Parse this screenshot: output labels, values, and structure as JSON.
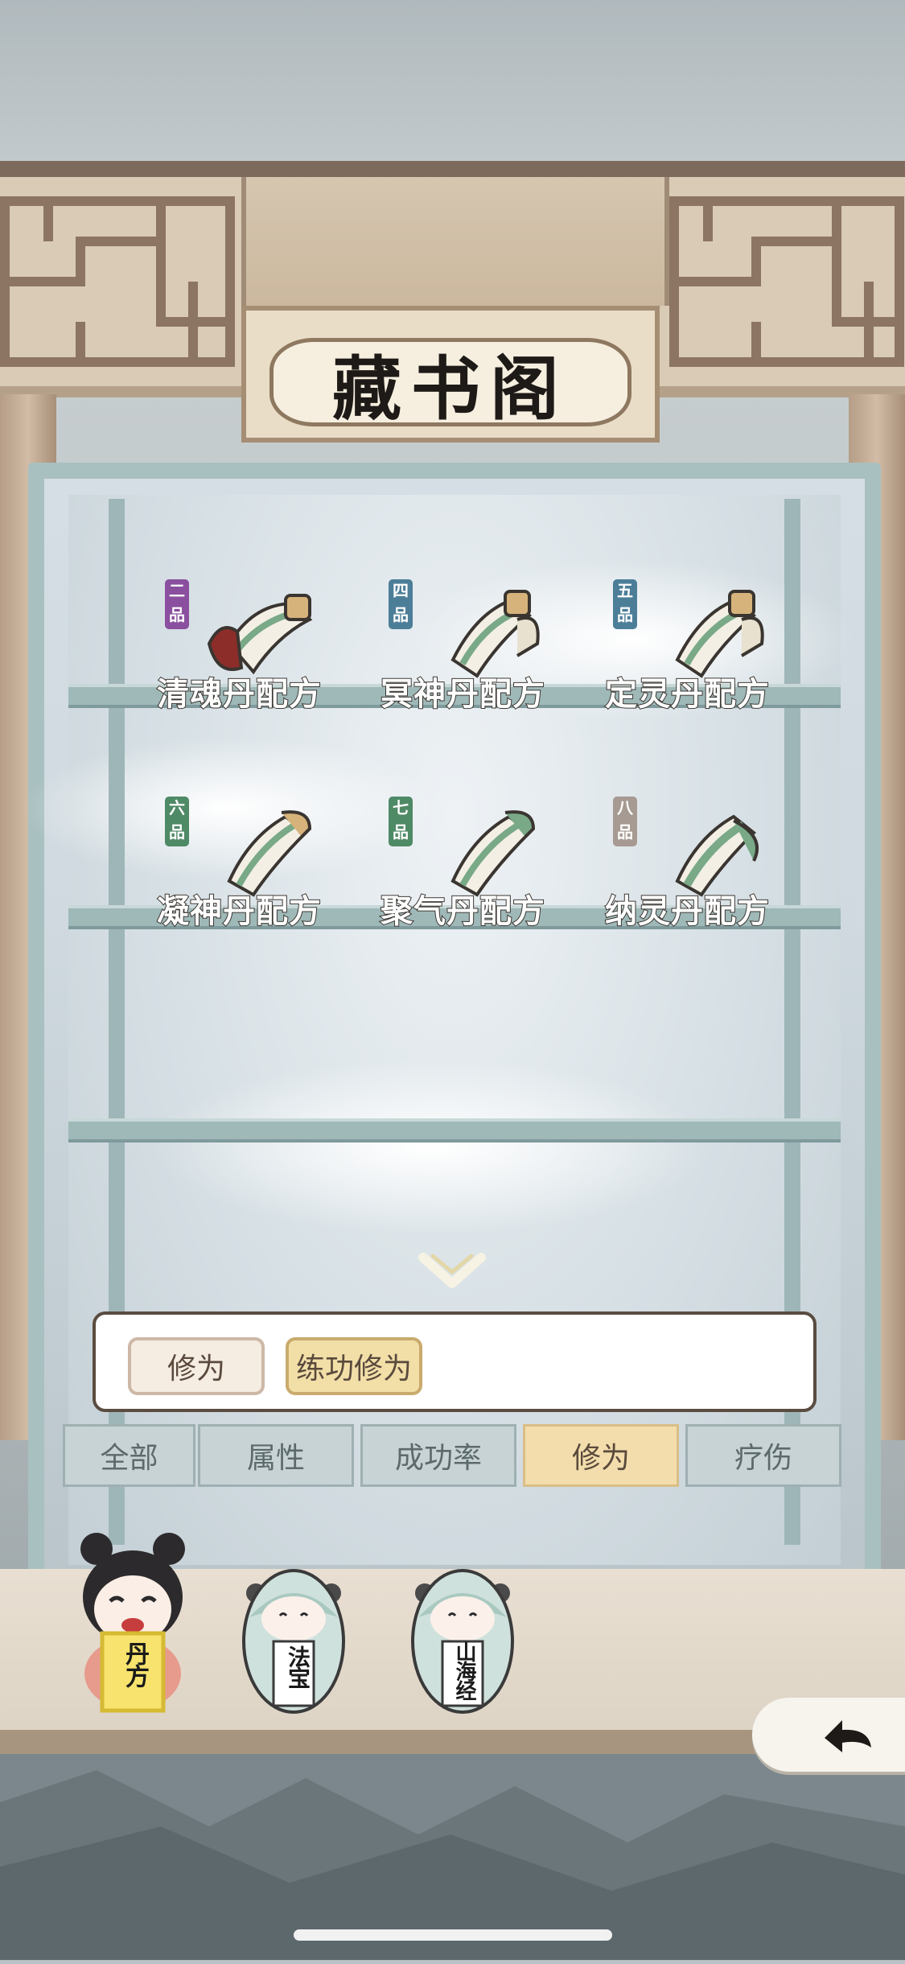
{
  "header": {
    "title": "藏书阁"
  },
  "items": [
    {
      "name": "清魂丹配方",
      "grade": "二品",
      "grade_color": "#8a4f9e",
      "seal_color": "#8c2d2a"
    },
    {
      "name": "冥神丹配方",
      "grade": "四品",
      "grade_color": "#4c7e98",
      "seal_color": "#5d8d6e"
    },
    {
      "name": "定灵丹配方",
      "grade": "五品",
      "grade_color": "#4c7e98",
      "seal_color": "#5d8d6e"
    },
    {
      "name": "凝神丹配方",
      "grade": "六品",
      "grade_color": "#4f8a66",
      "seal_color": "#5d8d6e"
    },
    {
      "name": "聚气丹配方",
      "grade": "七品",
      "grade_color": "#4f8a66",
      "seal_color": "#5d8d6e"
    },
    {
      "name": "纳灵丹配方",
      "grade": "八品",
      "grade_color": "#a69a92",
      "seal_color": "#5d8d6e"
    }
  ],
  "filter": {
    "chips": [
      "修为",
      "练功修为"
    ]
  },
  "tabs": [
    {
      "label": "全部",
      "active": false
    },
    {
      "label": "属性",
      "active": false
    },
    {
      "label": "成功率",
      "active": false
    },
    {
      "label": "修为",
      "active": true
    },
    {
      "label": "疗伤",
      "active": false
    }
  ],
  "characters": [
    {
      "label": "丹方",
      "selected": true
    },
    {
      "label": "法宝",
      "selected": false
    },
    {
      "label": "山海经",
      "selected": false
    }
  ],
  "icons": {
    "back": "back-arrow-icon",
    "expand": "chevron-down-icon"
  }
}
